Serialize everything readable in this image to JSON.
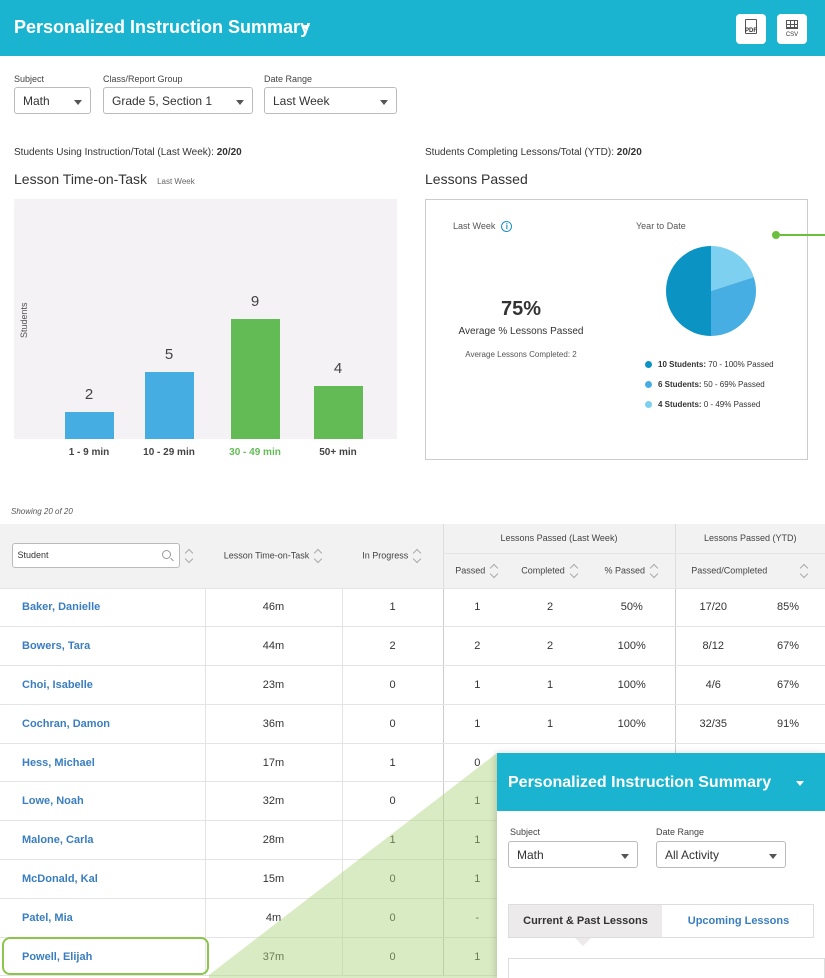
{
  "header": {
    "title": "Personalized Instruction Summary",
    "pdf_label": "PDF",
    "csv_label": "CSV"
  },
  "filters": {
    "subject_label": "Subject",
    "subject_value": "Math",
    "class_label": "Class/Report Group",
    "class_value": "Grade 5, Section 1",
    "range_label": "Date Range",
    "range_value": "Last Week"
  },
  "stats": {
    "using_label": "Students Using Instruction/Total (Last Week):",
    "using_value": "20/20",
    "completing_label": "Students Completing Lessons/Total (YTD):",
    "completing_value": "20/20"
  },
  "time_on_task": {
    "title": "Lesson Time-on-Task",
    "subtitle": "Last Week"
  },
  "chart_data": {
    "type": "bar",
    "categories": [
      "1 - 9 min",
      "10 - 29 min",
      "30 - 49 min",
      "50+ min"
    ],
    "values": [
      2,
      5,
      9,
      4
    ],
    "colors": [
      "#46ade3",
      "#46ade3",
      "#63bb55",
      "#63bb55"
    ],
    "highlight_category_color": "#63bb55",
    "ylabel": "Students",
    "ylim": [
      0,
      10
    ]
  },
  "lessons_passed": {
    "title": "Lessons Passed",
    "last_week_label": "Last Week",
    "ytd_label": "Year to Date",
    "avg_pct": "75%",
    "avg_pct_caption": "Average % Lessons Passed",
    "avg_completed": "Average Lessons Completed: 2",
    "pie": [
      {
        "count": 10,
        "bold": "10 Students:",
        "rest": "70 - 100% Passed",
        "color": "#0b93c3"
      },
      {
        "count": 6,
        "bold": "6 Students:",
        "rest": "50 - 69% Passed",
        "color": "#47aee3"
      },
      {
        "count": 4,
        "bold": "4 Students:",
        "rest": "0 - 49% Passed",
        "color": "#7dd0ef"
      }
    ]
  },
  "table": {
    "showing": "Showing 20 of 20",
    "search_placeholder": "Student",
    "col_time": "Lesson Time-on-Task",
    "col_progress": "In Progress",
    "group_lw": "Lessons Passed (Last Week)",
    "group_ytd": "Lessons Passed (YTD)",
    "col_passed": "Passed",
    "col_completed": "Completed",
    "col_pct": "% Passed",
    "col_passed_completed": "Passed/Completed",
    "rows": [
      {
        "name": "Baker, Danielle",
        "time": "46m",
        "progress": "1",
        "passed": "1",
        "completed": "2",
        "pct": "50%",
        "ytd": "17/20",
        "ytd_pct": "85%"
      },
      {
        "name": "Bowers, Tara",
        "time": "44m",
        "progress": "2",
        "passed": "2",
        "completed": "2",
        "pct": "100%",
        "ytd": "8/12",
        "ytd_pct": "67%"
      },
      {
        "name": "Choi, Isabelle",
        "time": "23m",
        "progress": "0",
        "passed": "1",
        "completed": "1",
        "pct": "100%",
        "ytd": "4/6",
        "ytd_pct": "67%"
      },
      {
        "name": "Cochran, Damon",
        "time": "36m",
        "progress": "0",
        "passed": "1",
        "completed": "1",
        "pct": "100%",
        "ytd": "32/35",
        "ytd_pct": "91%"
      },
      {
        "name": "Hess, Michael",
        "time": "17m",
        "progress": "1",
        "passed": "0",
        "completed": "",
        "pct": "",
        "ytd": "",
        "ytd_pct": ""
      },
      {
        "name": "Lowe, Noah",
        "time": "32m",
        "progress": "0",
        "passed": "1",
        "completed": "",
        "pct": "",
        "ytd": "",
        "ytd_pct": ""
      },
      {
        "name": "Malone, Carla",
        "time": "28m",
        "progress": "1",
        "passed": "1",
        "completed": "",
        "pct": "",
        "ytd": "",
        "ytd_pct": ""
      },
      {
        "name": "McDonald, Kal",
        "time": "15m",
        "progress": "0",
        "passed": "1",
        "completed": "",
        "pct": "",
        "ytd": "",
        "ytd_pct": ""
      },
      {
        "name": "Patel, Mia",
        "time": "4m",
        "progress": "0",
        "passed": "-",
        "completed": "",
        "pct": "",
        "ytd": "",
        "ytd_pct": ""
      },
      {
        "name": "Powell, Elijah",
        "time": "37m",
        "progress": "0",
        "passed": "1",
        "completed": "",
        "pct": "",
        "ytd": "",
        "ytd_pct": ""
      }
    ]
  },
  "zoom_view": {
    "title": "Personalized Instruction Summary",
    "subject_label": "Subject",
    "subject_value": "Math",
    "range_label": "Date Range",
    "range_value": "All Activity",
    "tab_current": "Current & Past Lessons",
    "tab_upcoming": "Upcoming Lessons"
  }
}
